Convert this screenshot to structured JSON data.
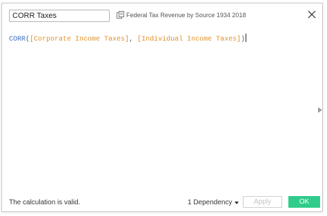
{
  "calc": {
    "name": "CORR Taxes"
  },
  "source": {
    "icon": "datasource-icon",
    "label": "Federal Tax Revenue by Source 1934  2018"
  },
  "formula": {
    "function": "CORR",
    "open_paren": "(",
    "arg1": "[Corporate Income Taxes]",
    "separator": ", ",
    "arg2": "[Individual Income Taxes]",
    "close_paren": ")"
  },
  "footer": {
    "status": "The calculation is valid.",
    "dependency": "1 Dependency",
    "apply_label": "Apply",
    "ok_label": "OK"
  },
  "colors": {
    "function": "#3a6ec2",
    "field": "#e0912c",
    "ok_bg": "#2fcc8c"
  }
}
